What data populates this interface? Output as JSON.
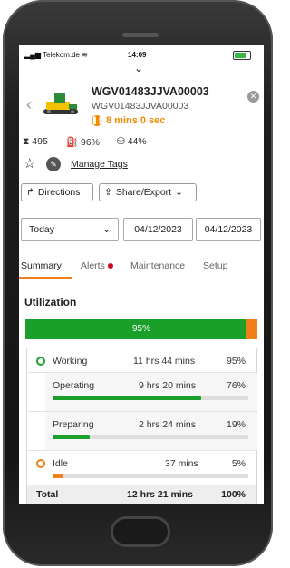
{
  "status_bar": {
    "carrier": "Telekom.de",
    "time": "14:09"
  },
  "machine": {
    "id": "WGV01483JJVA00003",
    "serial": "WGV01483JJVA00003",
    "state_text": "8 mins 0 sec",
    "hours": "495",
    "fuel": "96%",
    "def": "44%"
  },
  "actions": {
    "manage_tags": "Manage Tags",
    "directions": "Directions",
    "share_export": "Share/Export"
  },
  "filters": {
    "range": "Today",
    "start_date": "04/12/2023",
    "end_date": "04/12/2023"
  },
  "tabs": [
    "Summary",
    "Alerts",
    "Maintenance",
    "Setup"
  ],
  "utilization": {
    "title": "Utilization",
    "percent_label": "95%",
    "used_fraction": 0.95,
    "rows": [
      {
        "label": "Working",
        "time": "11 hrs 44 mins",
        "pct": "95%",
        "value": 95,
        "kind": "main",
        "dot": "green"
      },
      {
        "label": "Operating",
        "time": "9 hrs 20 mins",
        "pct": "76%",
        "value": 76,
        "kind": "sub",
        "color": "#1a9f2a"
      },
      {
        "label": "Preparing",
        "time": "2 hrs 24 mins",
        "pct": "19%",
        "value": 19,
        "kind": "sub",
        "color": "#1a9f2a"
      },
      {
        "label": "Idle",
        "time": "37 mins",
        "pct": "5%",
        "value": 5,
        "kind": "idle",
        "dot": "orange",
        "color": "#f07f1a"
      }
    ],
    "total": {
      "label": "Total",
      "time": "12 hrs 21 mins",
      "pct": "100%"
    }
  },
  "colors": {
    "green": "#1a9f2a",
    "orange": "#f07f1a",
    "alert_red": "#d0021b"
  }
}
